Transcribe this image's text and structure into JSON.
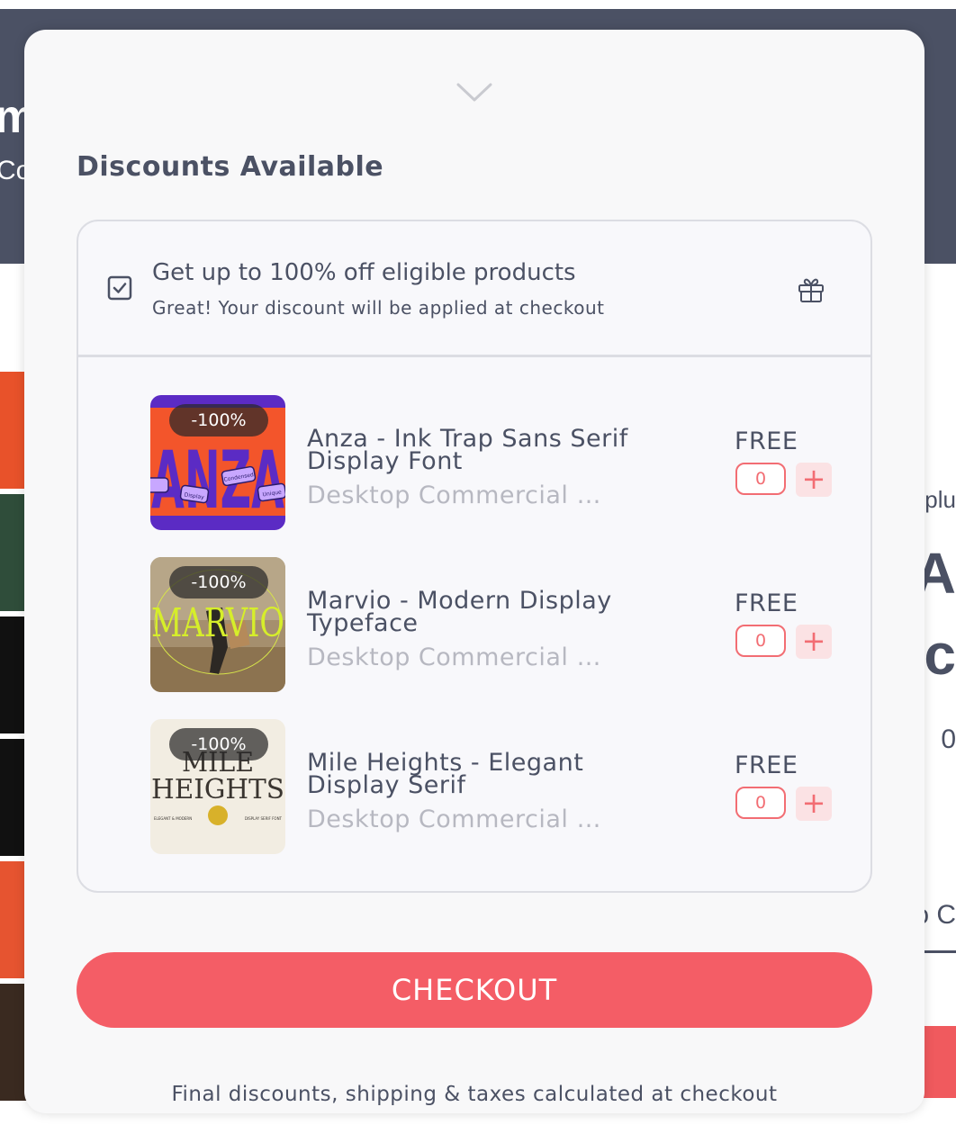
{
  "background": {
    "header_letters": "m",
    "header_sub": "Co",
    "right_texts": [
      "plu",
      "e A",
      "nc",
      "0",
      "o C"
    ]
  },
  "modal": {
    "title": "Discounts Available",
    "offer": {
      "checked": true,
      "title": "Get up to 100% off eligible products",
      "subtitle": "Great! Your discount will be applied at checkout"
    },
    "products": [
      {
        "badge": "-100%",
        "name": "Anza - Ink Trap Sans Serif Display Font",
        "license": "Desktop Commercial Li...",
        "price": "FREE",
        "quantity": "0",
        "thumb_text": "ANZA",
        "thumb_tags": [
          "Condensed",
          "Display",
          "Bold",
          "Unique"
        ]
      },
      {
        "badge": "-100%",
        "name": "Marvio - Modern Display Typeface",
        "license": "Desktop Commercial Li...",
        "price": "FREE",
        "quantity": "0",
        "thumb_text": "MARVIO"
      },
      {
        "badge": "-100%",
        "name": "Mile Heights - Elegant Display Serif",
        "license": "Desktop Commercial Li...",
        "price": "FREE",
        "quantity": "0",
        "thumb_text_1": "MILE",
        "thumb_text_2": "HEIGHTS",
        "thumb_caption_left": "ELEGANT & MODERN",
        "thumb_caption_right": "DISPLAY SERIF FONT"
      }
    ],
    "plus_symbol": "+",
    "checkout_label": "CHECKOUT",
    "footnote": "Final discounts, shipping & taxes calculated at checkout"
  },
  "colors": {
    "header_bg": "#4b5164",
    "accent": "#f45d66",
    "text": "#4b5164",
    "muted": "#b7b8c1"
  },
  "icons": {
    "collapse": "chevron-down-icon",
    "offer_check": "checkbox-checked-icon",
    "gift": "gift-icon",
    "add": "plus-icon"
  }
}
